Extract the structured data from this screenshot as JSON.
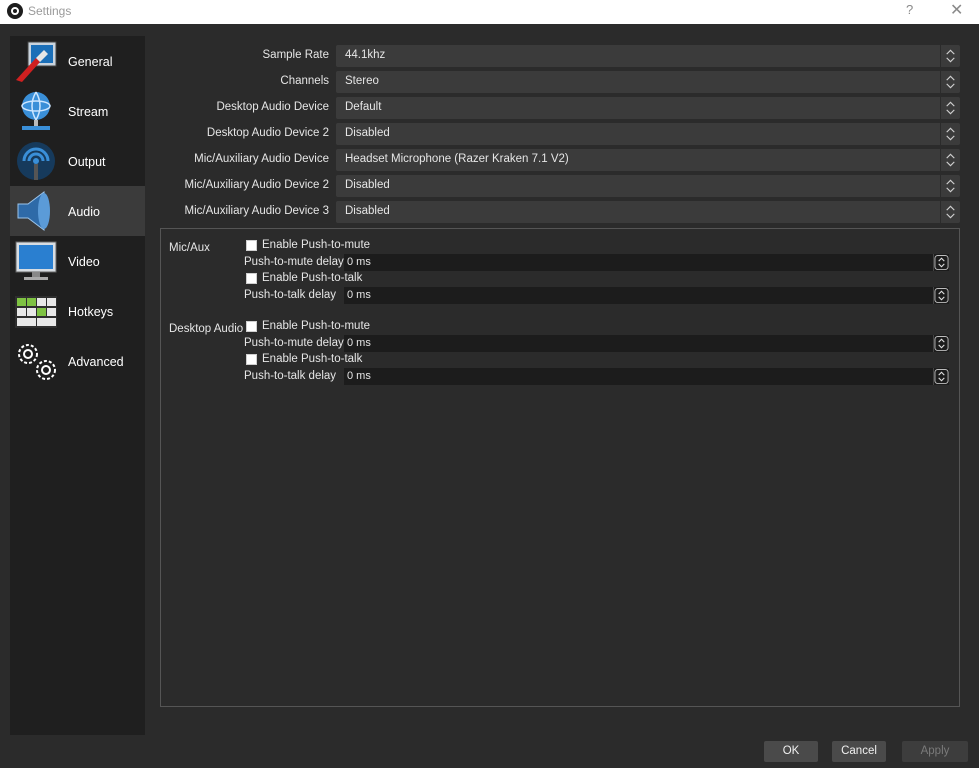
{
  "window": {
    "title": "Settings",
    "help": "?",
    "close": "✕"
  },
  "sidebar": {
    "items": [
      {
        "label": "General",
        "icon": "general-icon"
      },
      {
        "label": "Stream",
        "icon": "stream-icon"
      },
      {
        "label": "Output",
        "icon": "output-icon"
      },
      {
        "label": "Audio",
        "icon": "audio-icon",
        "active": true
      },
      {
        "label": "Video",
        "icon": "video-icon"
      },
      {
        "label": "Hotkeys",
        "icon": "hotkeys-icon"
      },
      {
        "label": "Advanced",
        "icon": "advanced-icon"
      }
    ]
  },
  "audio": {
    "rows": [
      {
        "label": "Sample Rate",
        "value": "44.1khz"
      },
      {
        "label": "Channels",
        "value": "Stereo"
      },
      {
        "label": "Desktop Audio Device",
        "value": "Default"
      },
      {
        "label": "Desktop Audio Device 2",
        "value": "Disabled"
      },
      {
        "label": "Mic/Auxiliary Audio Device",
        "value": "Headset Microphone (Razer Kraken 7.1 V2)"
      },
      {
        "label": "Mic/Auxiliary Audio Device 2",
        "value": "Disabled"
      },
      {
        "label": "Mic/Auxiliary Audio Device 3",
        "value": "Disabled"
      }
    ]
  },
  "hotkeys": {
    "groups": [
      {
        "name": "Mic/Aux",
        "mute_checkbox": "Enable Push-to-mute",
        "mute_delay_label": "Push-to-mute delay",
        "mute_delay_value": "0 ms",
        "talk_checkbox": "Enable Push-to-talk",
        "talk_delay_label": "Push-to-talk delay",
        "talk_delay_value": "0 ms"
      },
      {
        "name": "Desktop Audio",
        "mute_checkbox": "Enable Push-to-mute",
        "mute_delay_label": "Push-to-mute delay",
        "mute_delay_value": "0 ms",
        "talk_checkbox": "Enable Push-to-talk",
        "talk_delay_label": "Push-to-talk delay",
        "talk_delay_value": "0 ms"
      }
    ]
  },
  "buttons": {
    "ok": "OK",
    "cancel": "Cancel",
    "apply": "Apply"
  },
  "colors": {
    "background": "#2b2b2b",
    "sidebar": "#1f1f1f",
    "active_item": "#3b3b3b",
    "combo": "#3b3b3b"
  }
}
